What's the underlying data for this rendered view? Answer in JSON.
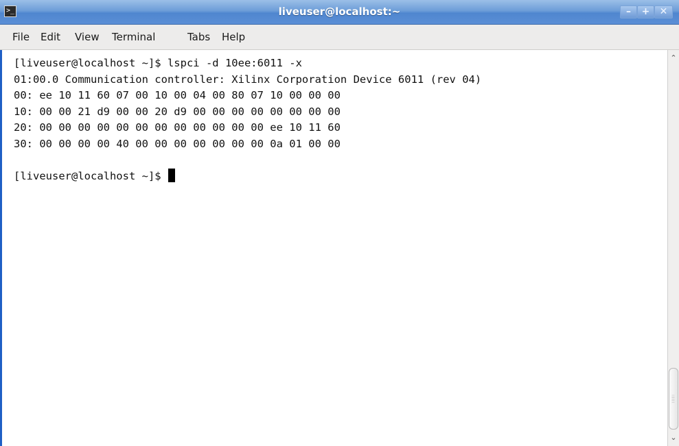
{
  "window": {
    "title": "liveuser@localhost:~",
    "app_icon": "terminal-icon",
    "buttons": {
      "minimize": "–",
      "maximize": "+",
      "close": "✕"
    }
  },
  "menubar": {
    "items": [
      "File",
      "Edit",
      "View",
      "Terminal",
      "Tabs",
      "Help"
    ]
  },
  "terminal": {
    "lines": [
      "[liveuser@localhost ~]$ lspci -d 10ee:6011 -x",
      "01:00.0 Communication controller: Xilinx Corporation Device 6011 (rev 04)",
      "00: ee 10 11 60 07 00 10 00 04 00 80 07 10 00 00 00",
      "10: 00 00 21 d9 00 00 20 d9 00 00 00 00 00 00 00 00",
      "20: 00 00 00 00 00 00 00 00 00 00 00 00 ee 10 11 60",
      "30: 00 00 00 00 40 00 00 00 00 00 00 00 0a 01 00 00",
      "",
      "[liveuser@localhost ~]$"
    ]
  },
  "colors": {
    "titlebar": "#5b8fd6",
    "terminal_bg": "#ffffff",
    "terminal_fg": "#111111",
    "accent_border": "#1f5fc5"
  }
}
